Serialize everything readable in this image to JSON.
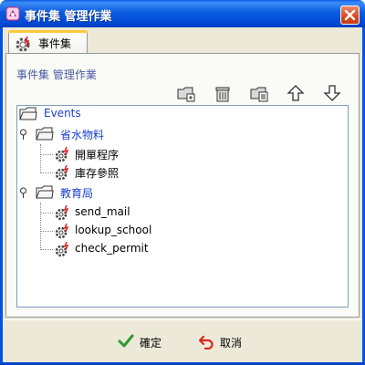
{
  "window": {
    "title": "事件集 管理作業"
  },
  "tab": {
    "label": "事件集"
  },
  "panel": {
    "section_label": "事件集 管理作業"
  },
  "toolbar": {
    "icons": [
      "new-folder-icon",
      "trash-icon",
      "edit-folder-icon",
      "arrow-up-icon",
      "arrow-down-icon"
    ]
  },
  "tree": {
    "root": "Events",
    "groups": [
      {
        "label": "省水物料",
        "items": [
          "開單程序",
          "庫存參照"
        ]
      },
      {
        "label": "教育局",
        "items": [
          "send_mail",
          "lookup_school",
          "check_permit"
        ]
      }
    ]
  },
  "footer": {
    "ok_label": "確定",
    "cancel_label": "取消"
  },
  "colors": {
    "title_bar": "#0054e3",
    "client_bg": "#ece9d8",
    "label_blue": "#1a3ccf",
    "section_label": "#4a5ba3"
  }
}
